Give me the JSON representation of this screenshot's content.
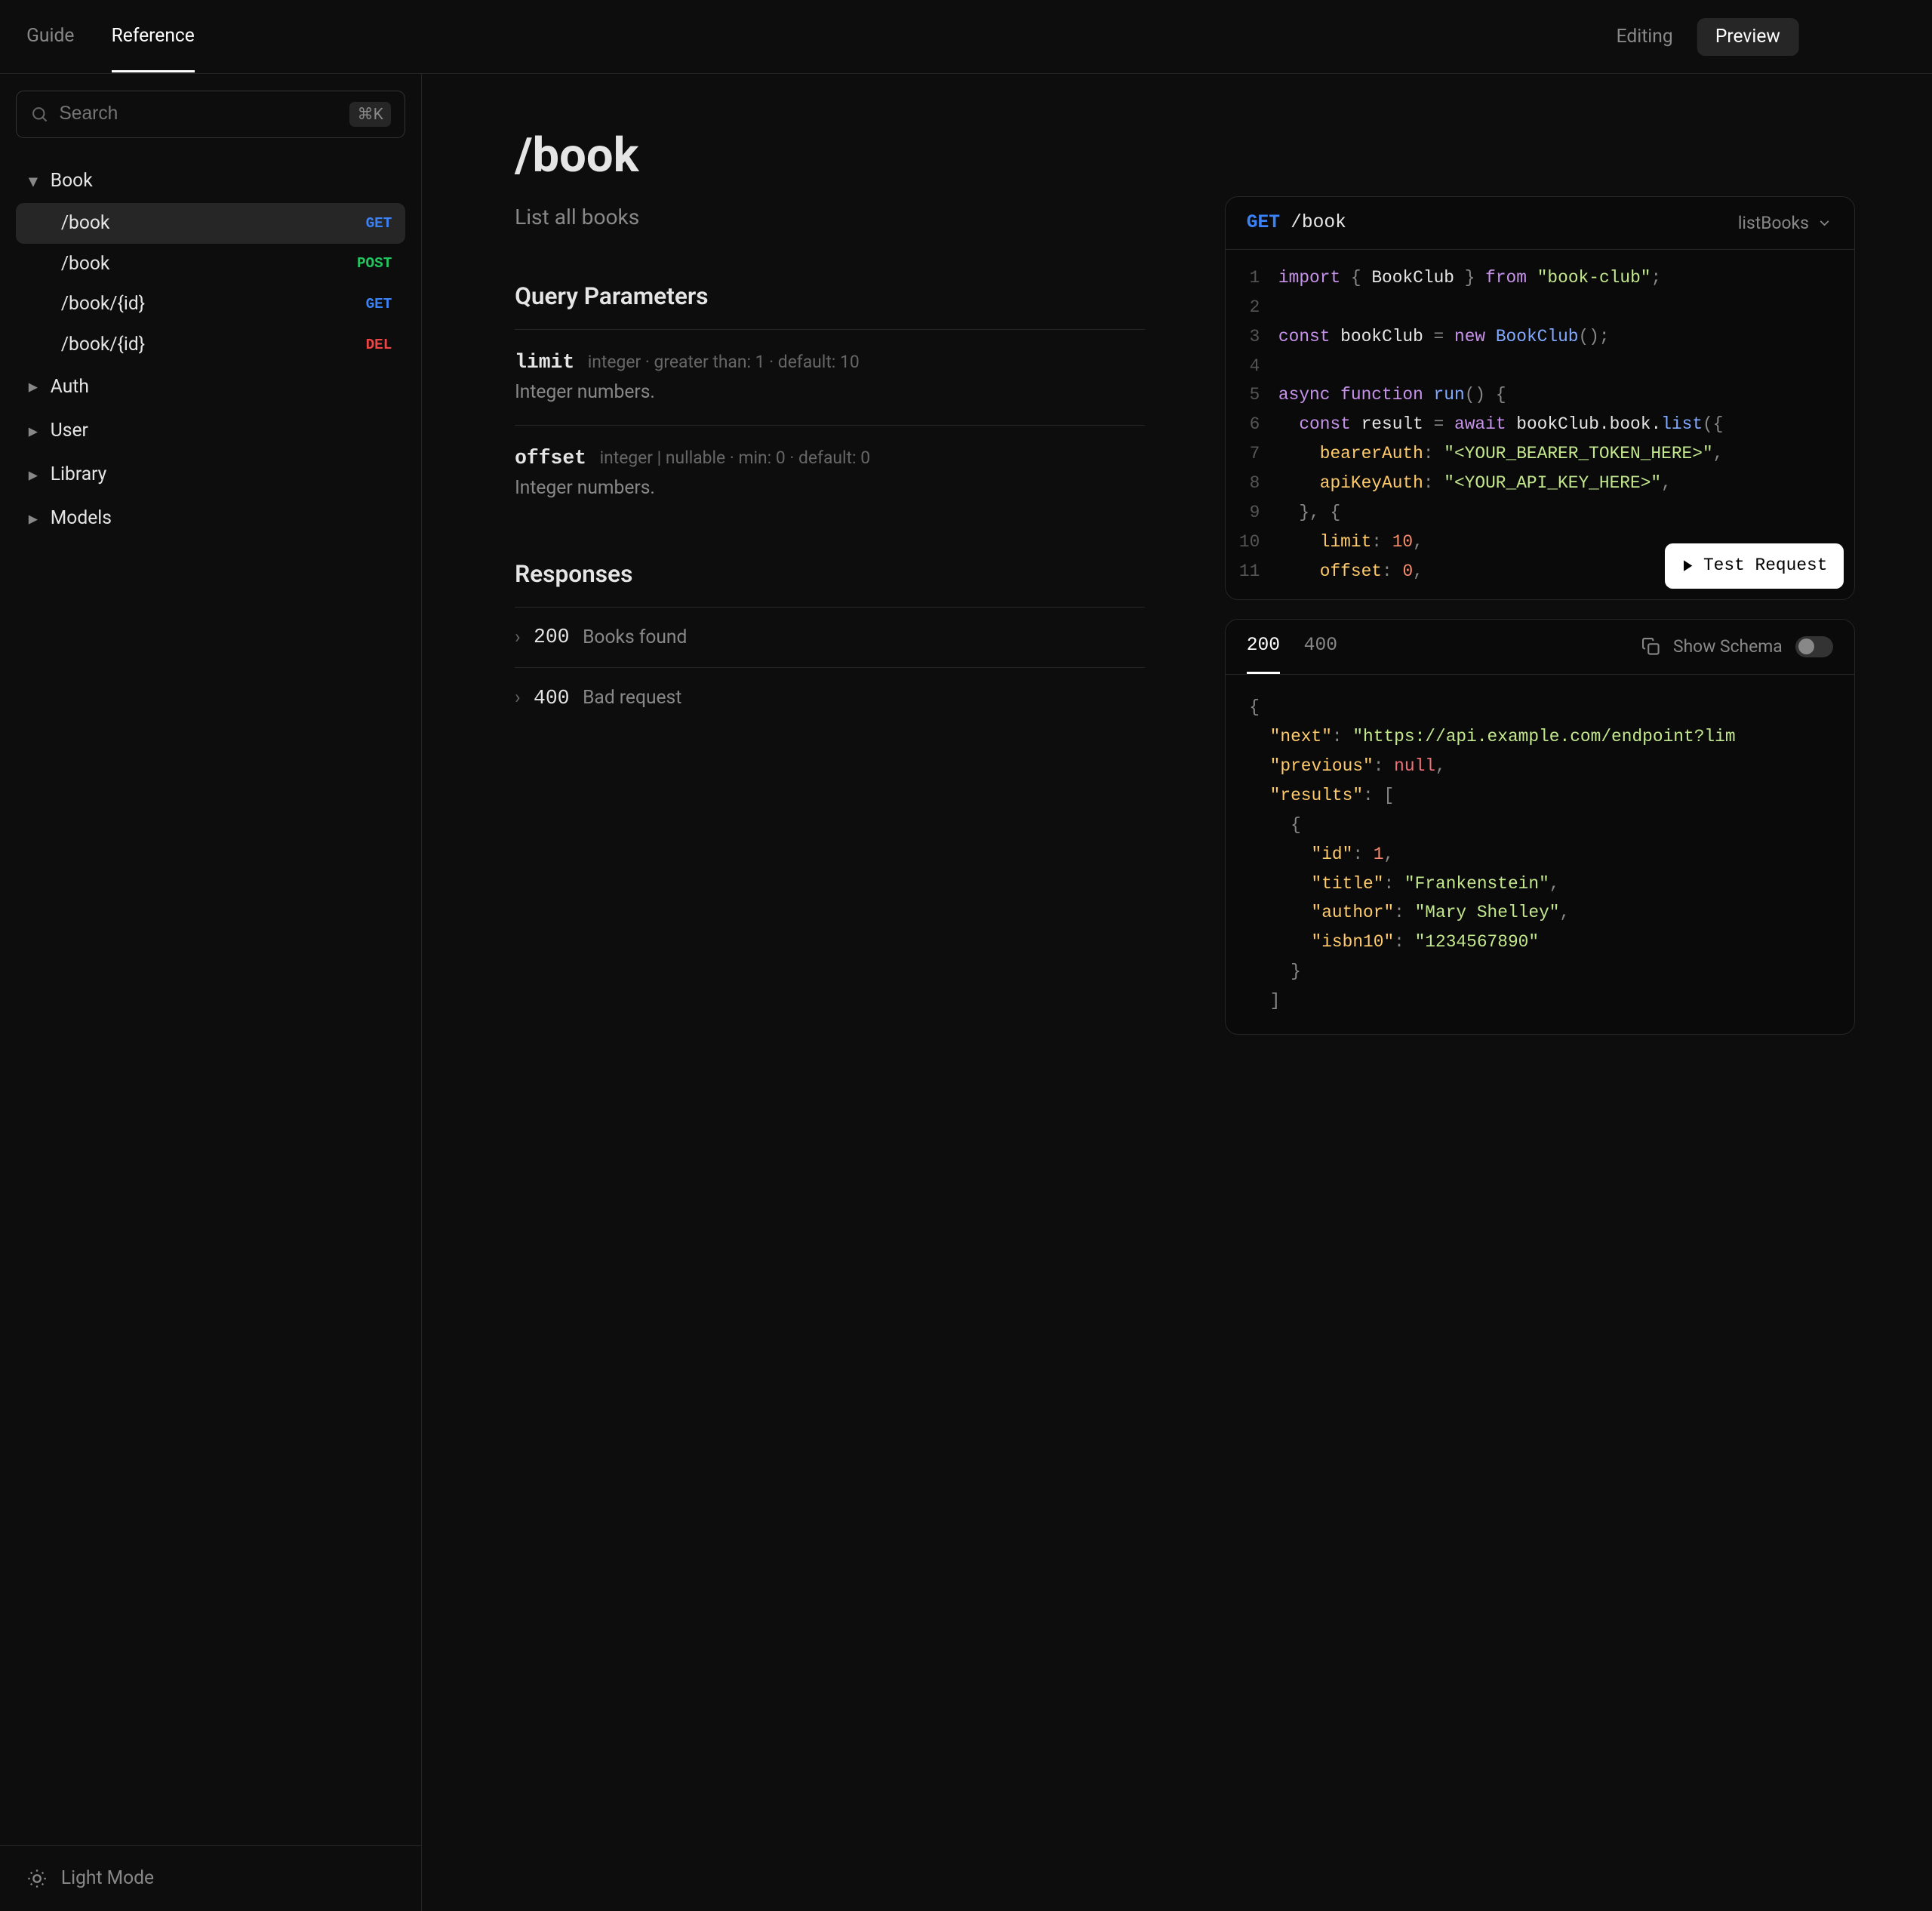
{
  "top_nav": {
    "tabs": [
      "Guide",
      "Reference"
    ],
    "active_tab": 1,
    "modes": [
      "Editing",
      "Preview"
    ],
    "active_mode": 1
  },
  "search": {
    "placeholder": "Search",
    "shortcut": "⌘K"
  },
  "sidebar": {
    "groups": [
      {
        "label": "Book",
        "expanded": true,
        "items": [
          {
            "path": "/book",
            "method": "GET",
            "active": true
          },
          {
            "path": "/book",
            "method": "POST"
          },
          {
            "path": "/book/{id}",
            "method": "GET"
          },
          {
            "path": "/book/{id}",
            "method": "DEL"
          }
        ]
      },
      {
        "label": "Auth",
        "expanded": false
      },
      {
        "label": "User",
        "expanded": false
      },
      {
        "label": "Library",
        "expanded": false
      },
      {
        "label": "Models",
        "expanded": false
      }
    ]
  },
  "theme_toggle": "Light Mode",
  "doc": {
    "title": "/book",
    "subtitle": "List all books",
    "params_heading": "Query Parameters",
    "params": [
      {
        "name": "limit",
        "meta": "integer · greater than: 1 · default: 10",
        "desc": "Integer numbers."
      },
      {
        "name": "offset",
        "meta": "integer | nullable · min: 0 · default: 0",
        "desc": "Integer numbers."
      }
    ],
    "responses_heading": "Responses",
    "responses": [
      {
        "code": "200",
        "label": "Books found"
      },
      {
        "code": "400",
        "label": "Bad request"
      }
    ]
  },
  "request_panel": {
    "method": "GET",
    "path": "/book",
    "operation": "listBooks",
    "test_button": "Test Request",
    "code_lines": [
      [
        [
          "kw",
          "import"
        ],
        [
          "pn",
          " { "
        ],
        [
          "id",
          "BookClub"
        ],
        [
          "pn",
          " } "
        ],
        [
          "kw",
          "from"
        ],
        [
          "pn",
          " "
        ],
        [
          "str",
          "\"book-club\""
        ],
        [
          "pn",
          ";"
        ]
      ],
      [],
      [
        [
          "kw",
          "const"
        ],
        [
          "pn",
          " "
        ],
        [
          "id",
          "bookClub"
        ],
        [
          "pn",
          " = "
        ],
        [
          "kw",
          "new"
        ],
        [
          "pn",
          " "
        ],
        [
          "fn",
          "BookClub"
        ],
        [
          "pn",
          "();"
        ]
      ],
      [],
      [
        [
          "kw",
          "async function"
        ],
        [
          "pn",
          " "
        ],
        [
          "fn",
          "run"
        ],
        [
          "pn",
          "() {"
        ]
      ],
      [
        [
          "pn",
          "  "
        ],
        [
          "kw",
          "const"
        ],
        [
          "pn",
          " "
        ],
        [
          "id",
          "result"
        ],
        [
          "pn",
          " = "
        ],
        [
          "kw",
          "await"
        ],
        [
          "pn",
          " "
        ],
        [
          "id",
          "bookClub.book."
        ],
        [
          "fn",
          "list"
        ],
        [
          "pn",
          "({"
        ]
      ],
      [
        [
          "pn",
          "    "
        ],
        [
          "prop",
          "bearerAuth"
        ],
        [
          "pn",
          ": "
        ],
        [
          "str",
          "\"<YOUR_BEARER_TOKEN_HERE>\""
        ],
        [
          "pn",
          ","
        ]
      ],
      [
        [
          "pn",
          "    "
        ],
        [
          "prop",
          "apiKeyAuth"
        ],
        [
          "pn",
          ": "
        ],
        [
          "str",
          "\"<YOUR_API_KEY_HERE>\""
        ],
        [
          "pn",
          ","
        ]
      ],
      [
        [
          "pn",
          "  }, {"
        ]
      ],
      [
        [
          "pn",
          "    "
        ],
        [
          "prop",
          "limit"
        ],
        [
          "pn",
          ": "
        ],
        [
          "num",
          "10"
        ],
        [
          "pn",
          ","
        ]
      ],
      [
        [
          "pn",
          "    "
        ],
        [
          "prop",
          "offset"
        ],
        [
          "pn",
          ": "
        ],
        [
          "num",
          "0"
        ],
        [
          "pn",
          ","
        ]
      ]
    ]
  },
  "response_panel": {
    "tabs": [
      "200",
      "400"
    ],
    "active_tab": 0,
    "show_schema": "Show Schema",
    "json_lines": [
      [
        [
          "pn",
          "{"
        ]
      ],
      [
        [
          "pn",
          "  "
        ],
        [
          "prop",
          "\"next\""
        ],
        [
          "pn",
          ": "
        ],
        [
          "str",
          "\"https://api.example.com/endpoint?lim"
        ]
      ],
      [
        [
          "pn",
          "  "
        ],
        [
          "prop",
          "\"previous\""
        ],
        [
          "pn",
          ": "
        ],
        [
          "nul",
          "null"
        ],
        [
          "pn",
          ","
        ]
      ],
      [
        [
          "pn",
          "  "
        ],
        [
          "prop",
          "\"results\""
        ],
        [
          "pn",
          ": ["
        ]
      ],
      [
        [
          "pn",
          "    {"
        ]
      ],
      [
        [
          "pn",
          "      "
        ],
        [
          "prop",
          "\"id\""
        ],
        [
          "pn",
          ": "
        ],
        [
          "num",
          "1"
        ],
        [
          "pn",
          ","
        ]
      ],
      [
        [
          "pn",
          "      "
        ],
        [
          "prop",
          "\"title\""
        ],
        [
          "pn",
          ": "
        ],
        [
          "str",
          "\"Frankenstein\""
        ],
        [
          "pn",
          ","
        ]
      ],
      [
        [
          "pn",
          "      "
        ],
        [
          "prop",
          "\"author\""
        ],
        [
          "pn",
          ": "
        ],
        [
          "str",
          "\"Mary Shelley\""
        ],
        [
          "pn",
          ","
        ]
      ],
      [
        [
          "pn",
          "      "
        ],
        [
          "prop",
          "\"isbn10\""
        ],
        [
          "pn",
          ": "
        ],
        [
          "str",
          "\"1234567890\""
        ]
      ],
      [
        [
          "pn",
          "    }"
        ]
      ],
      [
        [
          "pn",
          "  ]"
        ]
      ]
    ]
  }
}
